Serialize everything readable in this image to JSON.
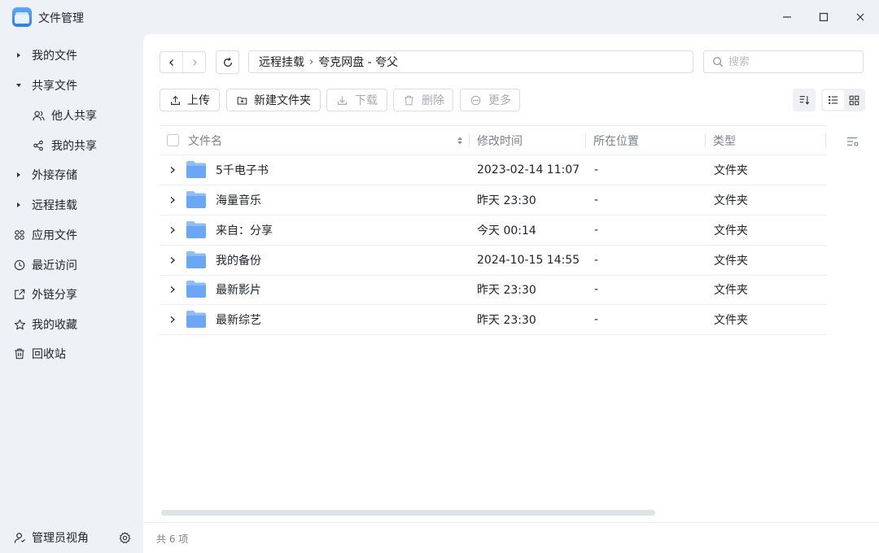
{
  "window": {
    "title": "文件管理"
  },
  "sidebar": {
    "items": [
      {
        "label": "我的文件",
        "icon": "caret-right-icon"
      },
      {
        "label": "共享文件",
        "icon": "caret-down-icon"
      },
      {
        "label": "他人共享",
        "icon": "users-icon"
      },
      {
        "label": "我的共享",
        "icon": "share-icon"
      },
      {
        "label": "外接存储",
        "icon": "caret-right-icon"
      },
      {
        "label": "远程挂载",
        "icon": "caret-right-icon"
      },
      {
        "label": "应用文件",
        "icon": "apps-icon"
      },
      {
        "label": "最近访问",
        "icon": "clock-icon"
      },
      {
        "label": "外链分享",
        "icon": "external-share-icon"
      },
      {
        "label": "我的收藏",
        "icon": "star-icon"
      },
      {
        "label": "回收站",
        "icon": "trash-icon"
      }
    ],
    "footer": {
      "admin_label": "管理员视角"
    }
  },
  "toolbar": {
    "path": [
      "远程挂载",
      "夸克网盘 - 夸父"
    ],
    "search_placeholder": "搜索",
    "upload_label": "上传",
    "new_folder_label": "新建文件夹",
    "download_label": "下载",
    "delete_label": "删除",
    "more_label": "更多"
  },
  "table": {
    "columns": [
      "文件名",
      "修改时间",
      "所在位置",
      "类型"
    ],
    "rows": [
      {
        "name": "5千电子书",
        "modified": "2023-02-14 11:07",
        "location": "-",
        "type": "文件夹"
      },
      {
        "name": "海量音乐",
        "modified": "昨天 23:30",
        "location": "-",
        "type": "文件夹"
      },
      {
        "name": "来自：分享",
        "modified": "今天 00:14",
        "location": "-",
        "type": "文件夹"
      },
      {
        "name": "我的备份",
        "modified": "2024-10-15 14:55",
        "location": "-",
        "type": "文件夹"
      },
      {
        "name": "最新影片",
        "modified": "昨天 23:30",
        "location": "-",
        "type": "文件夹"
      },
      {
        "name": "最新综艺",
        "modified": "昨天 23:30",
        "location": "-",
        "type": "文件夹"
      }
    ]
  },
  "status": {
    "count_label": "共 6 项"
  },
  "colors": {
    "accent": "#2d7cf0",
    "folder": "#79b0f8",
    "background": "#eef1f6",
    "panel": "#ffffff",
    "muted_text": "#7b8089"
  }
}
